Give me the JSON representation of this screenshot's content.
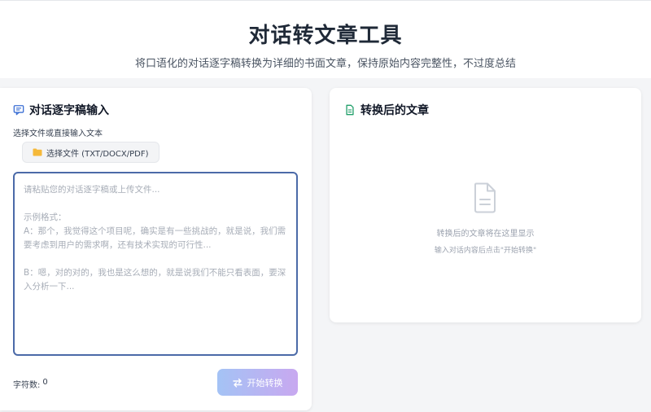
{
  "header": {
    "title": "对话转文章工具",
    "subtitle": "将口语化的对话逐字稿转换为详细的书面文章，保持原始内容完整性，不过度总结"
  },
  "input_panel": {
    "title": "对话逐字稿输入",
    "title_icon": "chat-icon",
    "hint": "选择文件或直接输入文本",
    "file_button_label": "选择文件 (TXT/DOCX/PDF)",
    "file_button_icon": "folder-icon",
    "textarea_placeholder": "请粘贴您的对话逐字稿或上传文件...\n\n示例格式：\nA：那个，我觉得这个项目呢，确实是有一些挑战的，就是说，我们需要考虑到用户的需求啊，还有技术实现的可行性...\n\nB：嗯，对的对的，我也是这么想的，就是说我们不能只看表面，要深入分析一下...",
    "char_count_label": "字符数:",
    "char_count_value": "0",
    "start_button_label": "开始转换",
    "start_button_icon": "swap-icon"
  },
  "output_panel": {
    "title": "转换后的文章",
    "title_icon": "document-icon",
    "empty_icon": "document-icon",
    "empty_message": "转换后的文章将在这里显示",
    "empty_hint": "输入对话内容后点击\"开始转换\""
  },
  "colors": {
    "accent_border": "#4b6aa8",
    "button_gradient_start": "#a4c3f5",
    "button_gradient_end": "#c8a8f0",
    "doc_icon_green": "#22a06b",
    "chat_icon_blue": "#3b6fd4",
    "folder_yellow": "#f5b93a"
  }
}
